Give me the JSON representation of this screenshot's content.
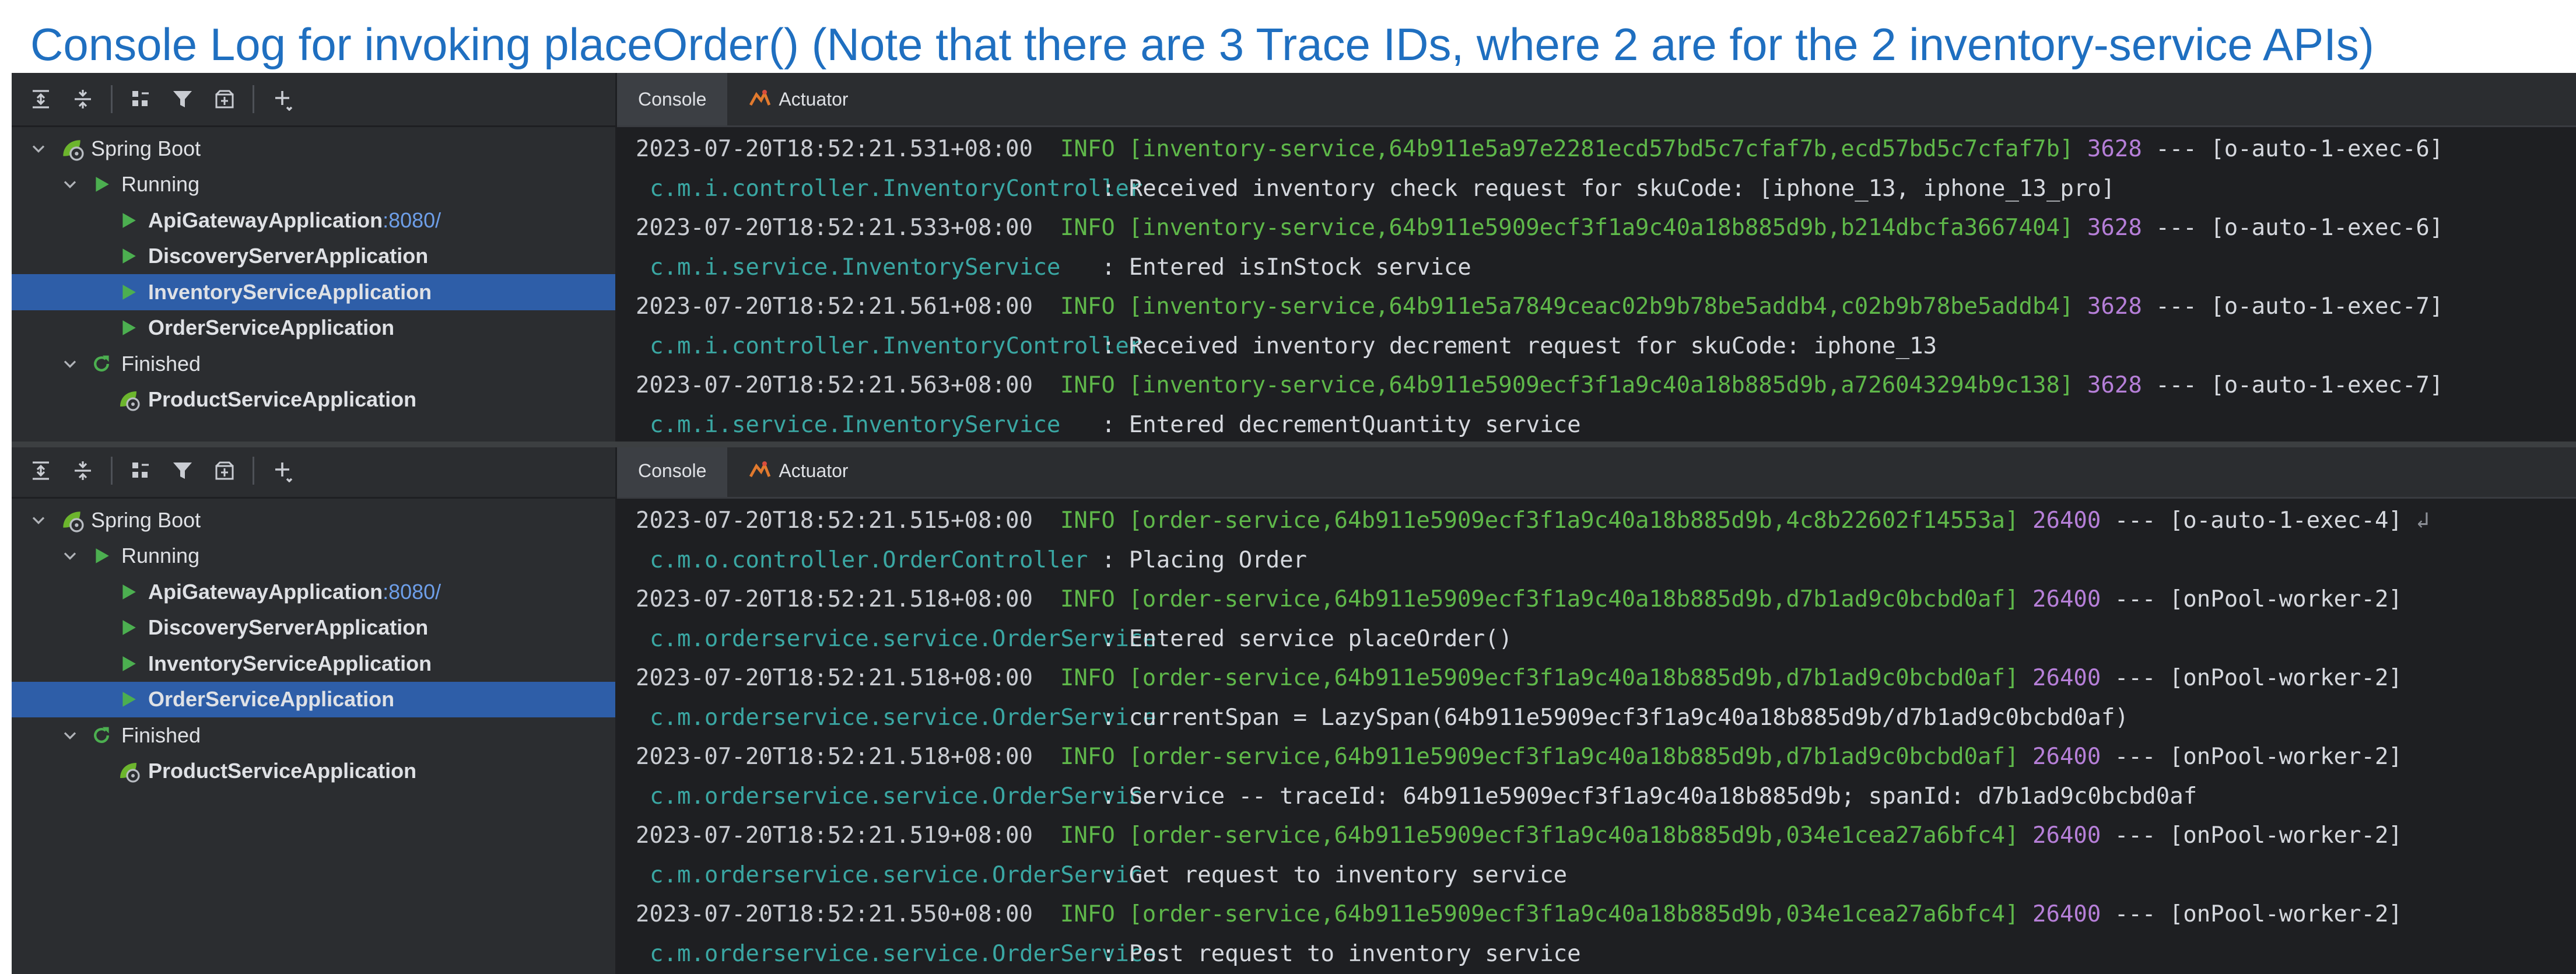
{
  "page_title": "Console Log for invoking placeOrder() (Note that there are 3 Trace IDs, where 2 are for the 2 inventory-service APIs)",
  "colors": {
    "title": "#1f6fc0",
    "selection": "#2e5ea8",
    "log_green": "#5fb84a",
    "log_purple": "#b67fd8",
    "log_teal": "#3aa7a3",
    "run_green": "#4caf50"
  },
  "panels": [
    {
      "toolbar_icons": [
        "expand-all-icon",
        "collapse-all-icon",
        "group-icon",
        "filter-icon",
        "new-tab-icon",
        "add-icon"
      ],
      "tree": {
        "root": "Spring Boot",
        "running_label": "Running",
        "running_apps": [
          {
            "name": "ApiGatewayApplication",
            "port": ":8080/"
          },
          {
            "name": "DiscoveryServerApplication",
            "port": ""
          },
          {
            "name": "InventoryServiceApplication",
            "port": ""
          },
          {
            "name": "OrderServiceApplication",
            "port": ""
          }
        ],
        "selected_app": "InventoryServiceApplication",
        "finished_label": "Finished",
        "finished_apps": [
          {
            "name": "ProductServiceApplication"
          }
        ]
      },
      "tabs": [
        {
          "label": "Console",
          "active": true
        },
        {
          "label": "Actuator",
          "active": false
        }
      ],
      "log": [
        {
          "ts": "2023-07-20T18:52:21.531+08:00",
          "level": "INFO",
          "trace": "[inventory-service,64b911e5a97e2281ecd57bd5c7cfaf7b,ecd57bd5c7cfaf7b]",
          "pid": "3628",
          "thread": "--- [o-auto-1-exec-6]",
          "cls": "c.m.i.controller.InventoryController",
          "msg": ": Received inventory check request for skuCode: [iphone_13, iphone_13_pro]"
        },
        {
          "ts": "2023-07-20T18:52:21.533+08:00",
          "level": "INFO",
          "trace": "[inventory-service,64b911e5909ecf3f1a9c40a18b885d9b,b214dbcfa3667404]",
          "pid": "3628",
          "thread": "--- [o-auto-1-exec-6]",
          "cls": "c.m.i.service.InventoryService",
          "msg": ": Entered isInStock service"
        },
        {
          "ts": "2023-07-20T18:52:21.561+08:00",
          "level": "INFO",
          "trace": "[inventory-service,64b911e5a7849ceac02b9b78be5addb4,c02b9b78be5addb4]",
          "pid": "3628",
          "thread": "--- [o-auto-1-exec-7]",
          "cls": "c.m.i.controller.InventoryController",
          "msg": ": Received inventory decrement request for skuCode: iphone_13"
        },
        {
          "ts": "2023-07-20T18:52:21.563+08:00",
          "level": "INFO",
          "trace": "[inventory-service,64b911e5909ecf3f1a9c40a18b885d9b,a726043294b9c138]",
          "pid": "3628",
          "thread": "--- [o-auto-1-exec-7]",
          "cls": "c.m.i.service.InventoryService",
          "msg": ": Entered decrementQuantity service"
        }
      ]
    },
    {
      "toolbar_icons": [
        "expand-all-icon",
        "collapse-all-icon",
        "group-icon",
        "filter-icon",
        "new-tab-icon",
        "add-icon"
      ],
      "tree": {
        "root": "Spring Boot",
        "running_label": "Running",
        "running_apps": [
          {
            "name": "ApiGatewayApplication",
            "port": ":8080/"
          },
          {
            "name": "DiscoveryServerApplication",
            "port": ""
          },
          {
            "name": "InventoryServiceApplication",
            "port": ""
          },
          {
            "name": "OrderServiceApplication",
            "port": ""
          }
        ],
        "selected_app": "OrderServiceApplication",
        "finished_label": "Finished",
        "finished_apps": [
          {
            "name": "ProductServiceApplication"
          }
        ]
      },
      "tabs": [
        {
          "label": "Console",
          "active": true
        },
        {
          "label": "Actuator",
          "active": false
        }
      ],
      "log": [
        {
          "ts": "2023-07-20T18:52:21.515+08:00",
          "level": "INFO",
          "trace": "[order-service,64b911e5909ecf3f1a9c40a18b885d9b,4c8b22602f14553a]",
          "pid": "26400",
          "thread": "--- [o-auto-1-exec-4]",
          "cls": "c.m.o.controller.OrderController",
          "msg": ": Placing Order",
          "wrapped": true
        },
        {
          "ts": "2023-07-20T18:52:21.518+08:00",
          "level": "INFO",
          "trace": "[order-service,64b911e5909ecf3f1a9c40a18b885d9b,d7b1ad9c0bcbd0af]",
          "pid": "26400",
          "thread": "--- [onPool-worker-2]",
          "cls": "c.m.orderservice.service.OrderService",
          "msg": ": Entered service placeOrder()"
        },
        {
          "ts": "2023-07-20T18:52:21.518+08:00",
          "level": "INFO",
          "trace": "[order-service,64b911e5909ecf3f1a9c40a18b885d9b,d7b1ad9c0bcbd0af]",
          "pid": "26400",
          "thread": "--- [onPool-worker-2]",
          "cls": "c.m.orderservice.service.OrderService",
          "msg": ": currentSpan = LazySpan(64b911e5909ecf3f1a9c40a18b885d9b/d7b1ad9c0bcbd0af)"
        },
        {
          "ts": "2023-07-20T18:52:21.518+08:00",
          "level": "INFO",
          "trace": "[order-service,64b911e5909ecf3f1a9c40a18b885d9b,d7b1ad9c0bcbd0af]",
          "pid": "26400",
          "thread": "--- [onPool-worker-2]",
          "cls": "c.m.orderservice.service.OrderService",
          "msg": ": Service -- traceId: 64b911e5909ecf3f1a9c40a18b885d9b; spanId: d7b1ad9c0bcbd0af"
        },
        {
          "ts": "2023-07-20T18:52:21.519+08:00",
          "level": "INFO",
          "trace": "[order-service,64b911e5909ecf3f1a9c40a18b885d9b,034e1cea27a6bfc4]",
          "pid": "26400",
          "thread": "--- [onPool-worker-2]",
          "cls": "c.m.orderservice.service.OrderService",
          "msg": ": Get request to inventory service"
        },
        {
          "ts": "2023-07-20T18:52:21.550+08:00",
          "level": "INFO",
          "trace": "[order-service,64b911e5909ecf3f1a9c40a18b885d9b,034e1cea27a6bfc4]",
          "pid": "26400",
          "thread": "--- [onPool-worker-2]",
          "cls": "c.m.orderservice.service.OrderService",
          "msg": ": Post request to inventory service"
        }
      ]
    }
  ]
}
